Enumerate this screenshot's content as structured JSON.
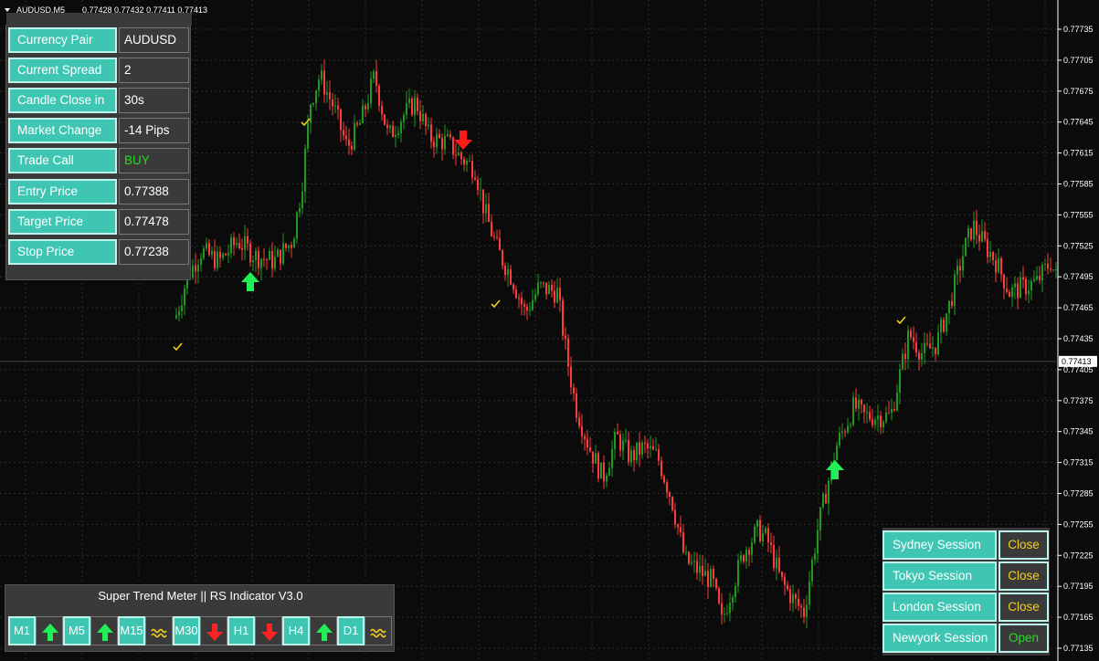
{
  "chart_header": {
    "symbol_timeframe": "AUDUSD,M5",
    "ohlc": "0.77428 0.77432 0.77411 0.77413"
  },
  "price_axis": {
    "ticks": [
      "0.77735",
      "0.77705",
      "0.77675",
      "0.77645",
      "0.77615",
      "0.77585",
      "0.77555",
      "0.77525",
      "0.77495",
      "0.77465",
      "0.77435",
      "0.77405",
      "0.77375",
      "0.77345",
      "0.77315",
      "0.77285",
      "0.77255",
      "0.77225",
      "0.77195",
      "0.77165",
      "0.77135"
    ],
    "current_price": "0.77413",
    "colors": {
      "up": "#1f9a1f",
      "down": "#ff3b3b",
      "grid": "#2e2e2e",
      "background": "#0b0b0b"
    }
  },
  "info_panel": {
    "rows": [
      {
        "label": "Currency Pair",
        "value": "AUDUSD"
      },
      {
        "label": "Current Spread",
        "value": "2"
      },
      {
        "label": "Candle Close in",
        "value": "30s"
      },
      {
        "label": "Market Change",
        "value": "-14 Pips"
      },
      {
        "label": "Trade Call",
        "value": "BUY",
        "value_color": "#22dd22"
      },
      {
        "label": "Entry Price",
        "value": "0.77388"
      },
      {
        "label": "Target Price",
        "value": "0.77478"
      },
      {
        "label": "Stop Price",
        "value": "0.77238"
      }
    ]
  },
  "sessions": {
    "rows": [
      {
        "label": "Sydney Session",
        "status": "Close",
        "status_color": "#f0d020"
      },
      {
        "label": "Tokyo Session",
        "status": "Close",
        "status_color": "#f0d020"
      },
      {
        "label": "London Session",
        "status": "Close",
        "status_color": "#f0d020"
      },
      {
        "label": "Newyork Session",
        "status": "Open",
        "status_color": "#22dd22"
      }
    ]
  },
  "trend_meter": {
    "title": "Super Trend Meter  ||  RS Indicator V3.0",
    "timeframes": [
      {
        "label": "M1",
        "signal": "up-arrow-icon"
      },
      {
        "label": "M5",
        "signal": "up-arrow-icon"
      },
      {
        "label": "M15",
        "signal": "sideways-wave-icon"
      },
      {
        "label": "M30",
        "signal": "down-arrow-icon"
      },
      {
        "label": "H1",
        "signal": "down-arrow-icon"
      },
      {
        "label": "H4",
        "signal": "up-arrow-icon"
      },
      {
        "label": "D1",
        "signal": "sideways-wave-icon"
      }
    ]
  }
}
